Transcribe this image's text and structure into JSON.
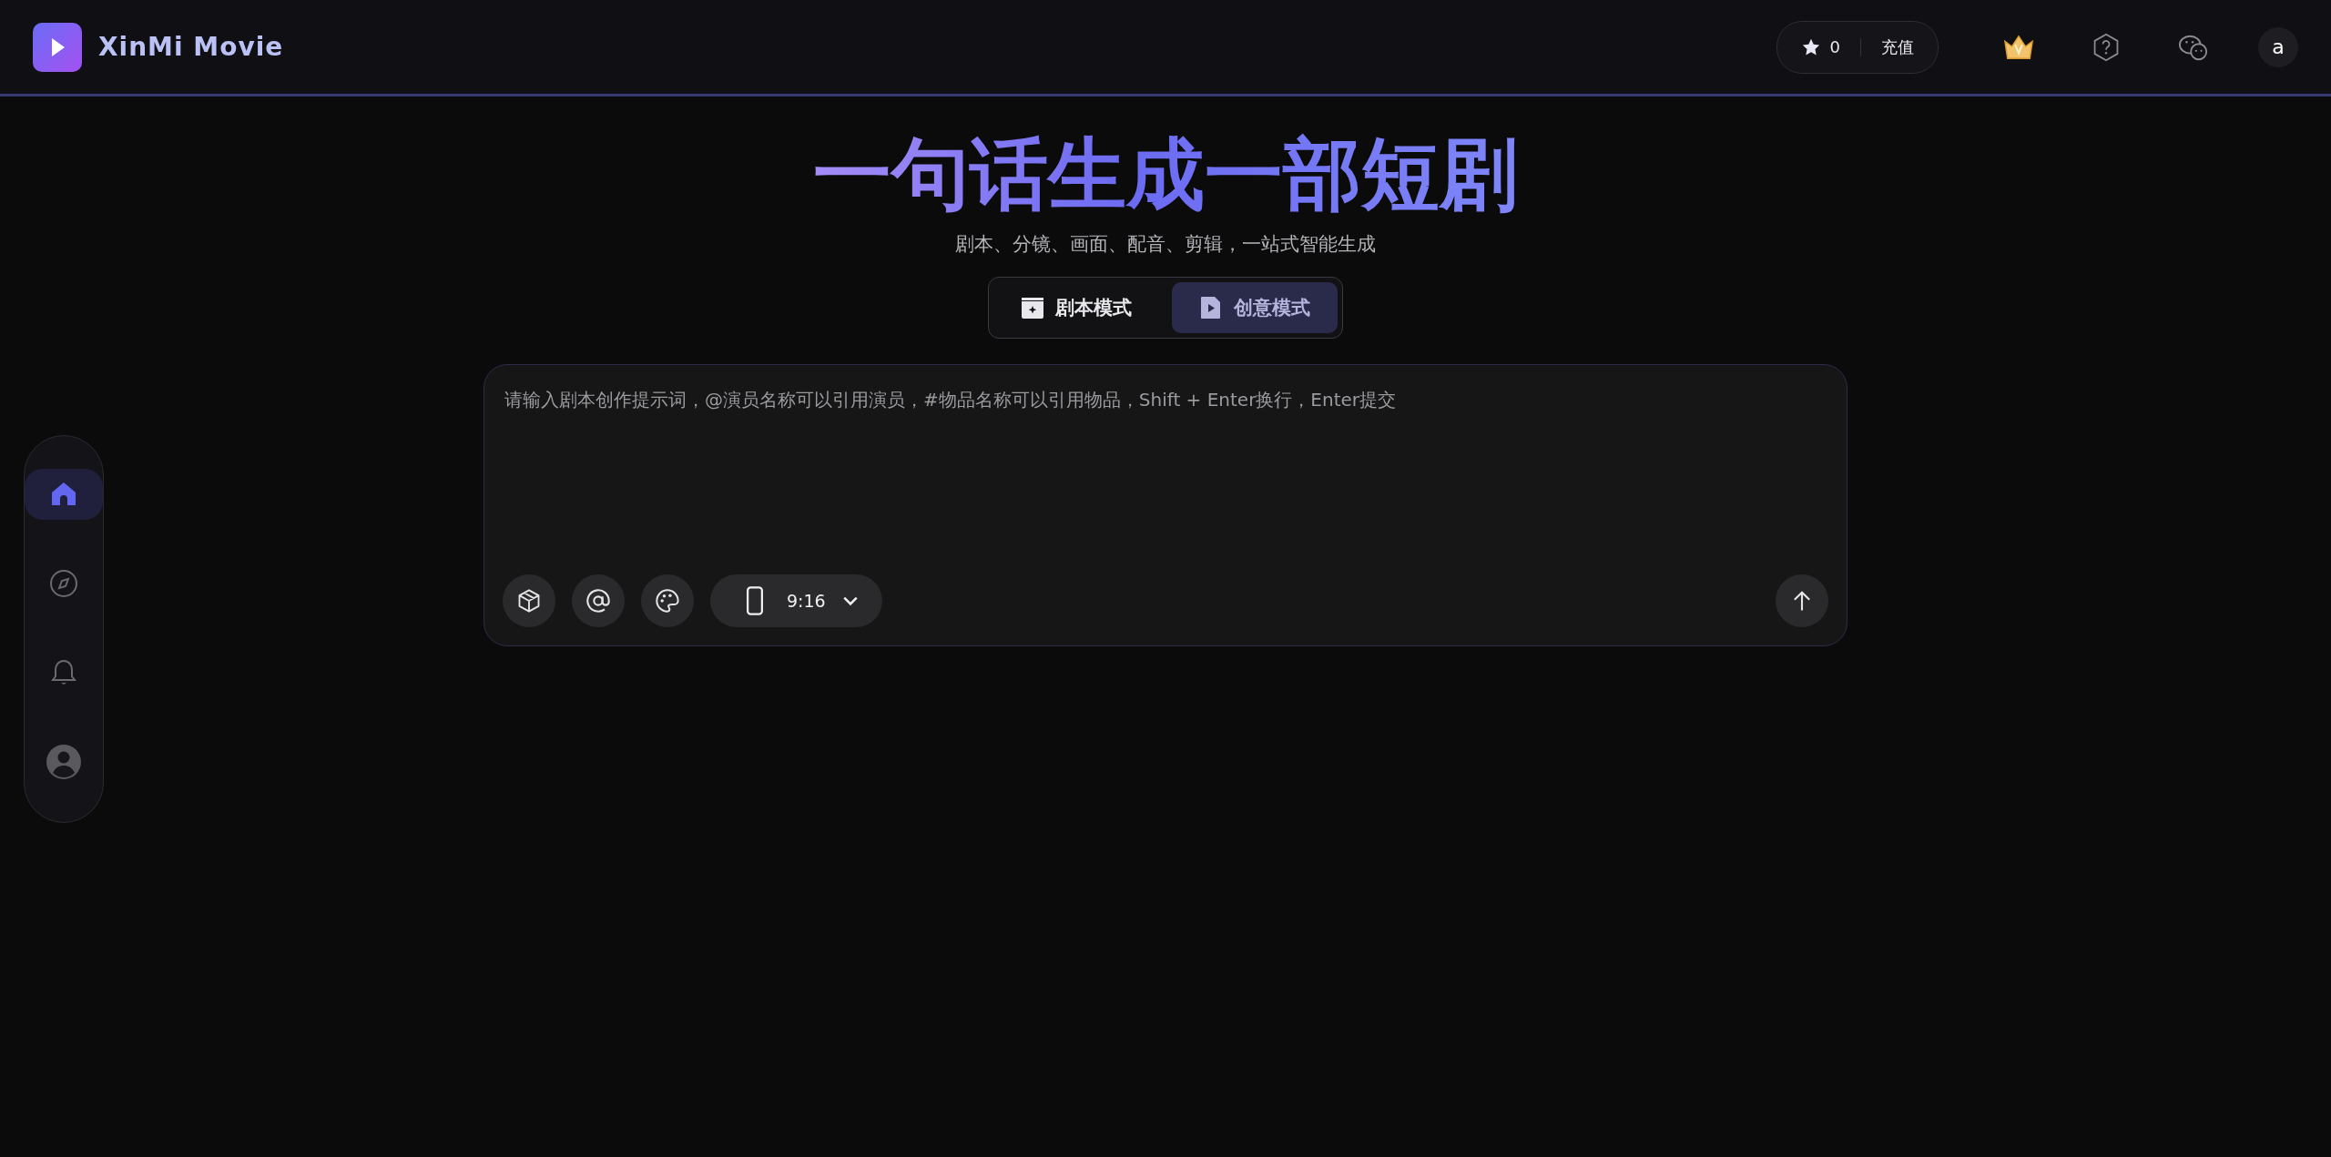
{
  "header": {
    "brand": "XinMi Movie",
    "credits": {
      "count": "0",
      "recharge_label": "充值"
    },
    "avatar_letter": "a"
  },
  "sidebar": {
    "items": [
      {
        "kind": "home",
        "selected": true
      },
      {
        "kind": "explore",
        "selected": false
      },
      {
        "kind": "notifications",
        "selected": false
      },
      {
        "kind": "profile",
        "selected": false
      }
    ]
  },
  "hero": {
    "title": "一句话生成一部短剧",
    "subtitle": "剧本、分镜、画面、配音、剪辑，一站式智能生成"
  },
  "modes": [
    {
      "kind": "script",
      "label": "剧本模式",
      "selected": false
    },
    {
      "kind": "creative",
      "label": "创意模式",
      "selected": true
    }
  ],
  "prompt": {
    "placeholder": "请输入剧本创作提示词，@演员名称可以引用演员，#物品名称可以引用物品，Shift + Enter换行，Enter提交",
    "aspect_ratio": "9:16"
  }
}
